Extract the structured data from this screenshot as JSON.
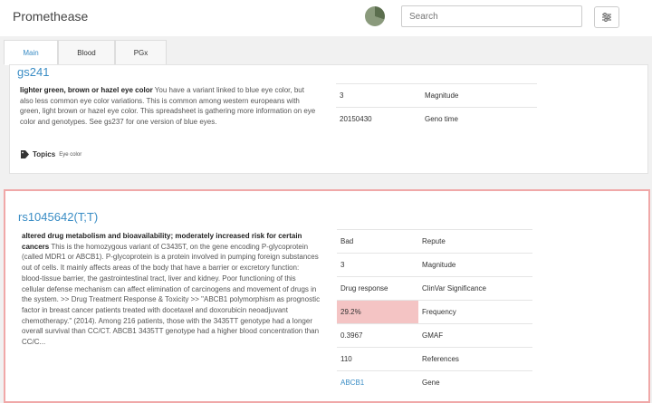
{
  "header": {
    "title": "Promethease",
    "search_placeholder": "Search"
  },
  "tabs": [
    {
      "label": "Main"
    },
    {
      "label": "Blood"
    },
    {
      "label": "PGx"
    }
  ],
  "card1": {
    "id": "gs241",
    "summary": "lighter green, brown or hazel eye color",
    "text": " You have a variant linked to blue eye color, but also less common eye color variations. This is common among western europeans with green, light brown or hazel eye color. This spreadsheet is gathering more information on eye color and genotypes. See gs237 for one version of blue eyes.",
    "topics_label": "Topics",
    "topic_tag": "Eye color",
    "facts": [
      {
        "value": "3",
        "label": "Magnitude"
      },
      {
        "value": "20150430",
        "label": "Geno time"
      }
    ]
  },
  "card2": {
    "id": "rs1045642(T;T)",
    "summary": "altered drug metabolism and bioavailability; moderately increased risk for certain cancers",
    "text": " This is the homozygous variant of C3435T, on the gene encoding P-glycoprotein (called MDR1 or ABCB1). P-glycoprotein is a protein involved in pumping foreign substances out of cells. It mainly affects areas of the body that have a barrier or excretory function: blood-tissue barrier, the gastrointestinal tract, liver and kidney. Poor functioning of this cellular defense mechanism can affect elimination of carcinogens and movement of drugs in the system. >> Drug Treatment Response & Toxicity >> \"ABCB1 polymorphism as prognostic factor in breast cancer patients treated with docetaxel and doxorubicin neoadjuvant chemotherapy.\" (2014). Among 216 patients, those with the 3435TT genotype had a longer overall survival than CC/CT. ABCB1 3435TT genotype had a higher blood concentration than CC/C...",
    "facts": [
      {
        "value": "Bad",
        "label": "Repute"
      },
      {
        "value": "3",
        "label": "Magnitude"
      },
      {
        "value": "Drug response",
        "label": "ClinVar Significance"
      },
      {
        "value": "29.2%",
        "label": "Frequency"
      },
      {
        "value": "0.3967",
        "label": "GMAF"
      },
      {
        "value": "110",
        "label": "References"
      },
      {
        "value": "ABCB1",
        "label": "Gene"
      }
    ]
  },
  "colors": {
    "accent": "#3a8dc5",
    "bad_border": "#f0a8a8",
    "frequency_highlight": "#f4c4c4"
  }
}
